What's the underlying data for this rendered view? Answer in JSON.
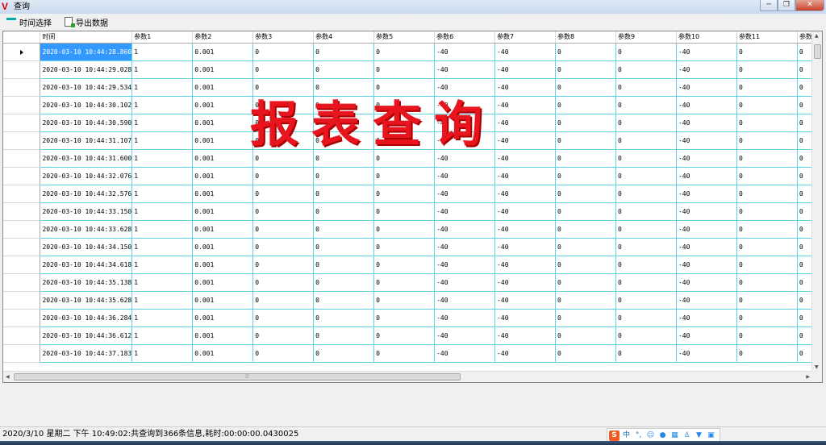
{
  "window": {
    "title": "查询",
    "icon": "v-logo-icon",
    "buttons": {
      "minimize": "─",
      "restore": "❐",
      "close": "✕"
    }
  },
  "toolbar": {
    "time_select_label": "时间选择",
    "export_label": "导出数据"
  },
  "overlay_title": "报表查询",
  "table": {
    "columns": [
      "时间",
      "参数1",
      "参数2",
      "参数3",
      "参数4",
      "参数5",
      "参数6",
      "参数7",
      "参数8",
      "参数9",
      "参数10",
      "参数11",
      "参数"
    ],
    "row_template": [
      "1",
      "0.001",
      "0",
      "0",
      "0",
      "-40",
      "-40",
      "0",
      "0",
      "-40",
      "0",
      "0"
    ],
    "times": [
      "2020-03-10 10:44:28.860",
      "2020-03-10 10:44:29.028",
      "2020-03-10 10:44:29.534",
      "2020-03-10 10:44:30.102",
      "2020-03-10 10:44:30.590",
      "2020-03-10 10:44:31.107",
      "2020-03-10 10:44:31.600",
      "2020-03-10 10:44:32.076",
      "2020-03-10 10:44:32.576",
      "2020-03-10 10:44:33.150",
      "2020-03-10 10:44:33.628",
      "2020-03-10 10:44:34.150",
      "2020-03-10 10:44:34.618",
      "2020-03-10 10:44:35.138",
      "2020-03-10 10:44:35.628",
      "2020-03-10 10:44:36.284",
      "2020-03-10 10:44:36.612",
      "2020-03-10 10:44:37.183"
    ],
    "selected_row": 0
  },
  "status": {
    "text": "2020/3/10 星期二 下午 10:49:02:共查询到366条信息,耗时:00:00:00.0430025"
  },
  "ime": {
    "logo": "S",
    "mode": "中",
    "punct": "°,",
    "icons": [
      "smiley-icon",
      "microphone-icon",
      "keyboard-icon",
      "person-icon",
      "shirt-icon",
      "grid-icon"
    ]
  }
}
